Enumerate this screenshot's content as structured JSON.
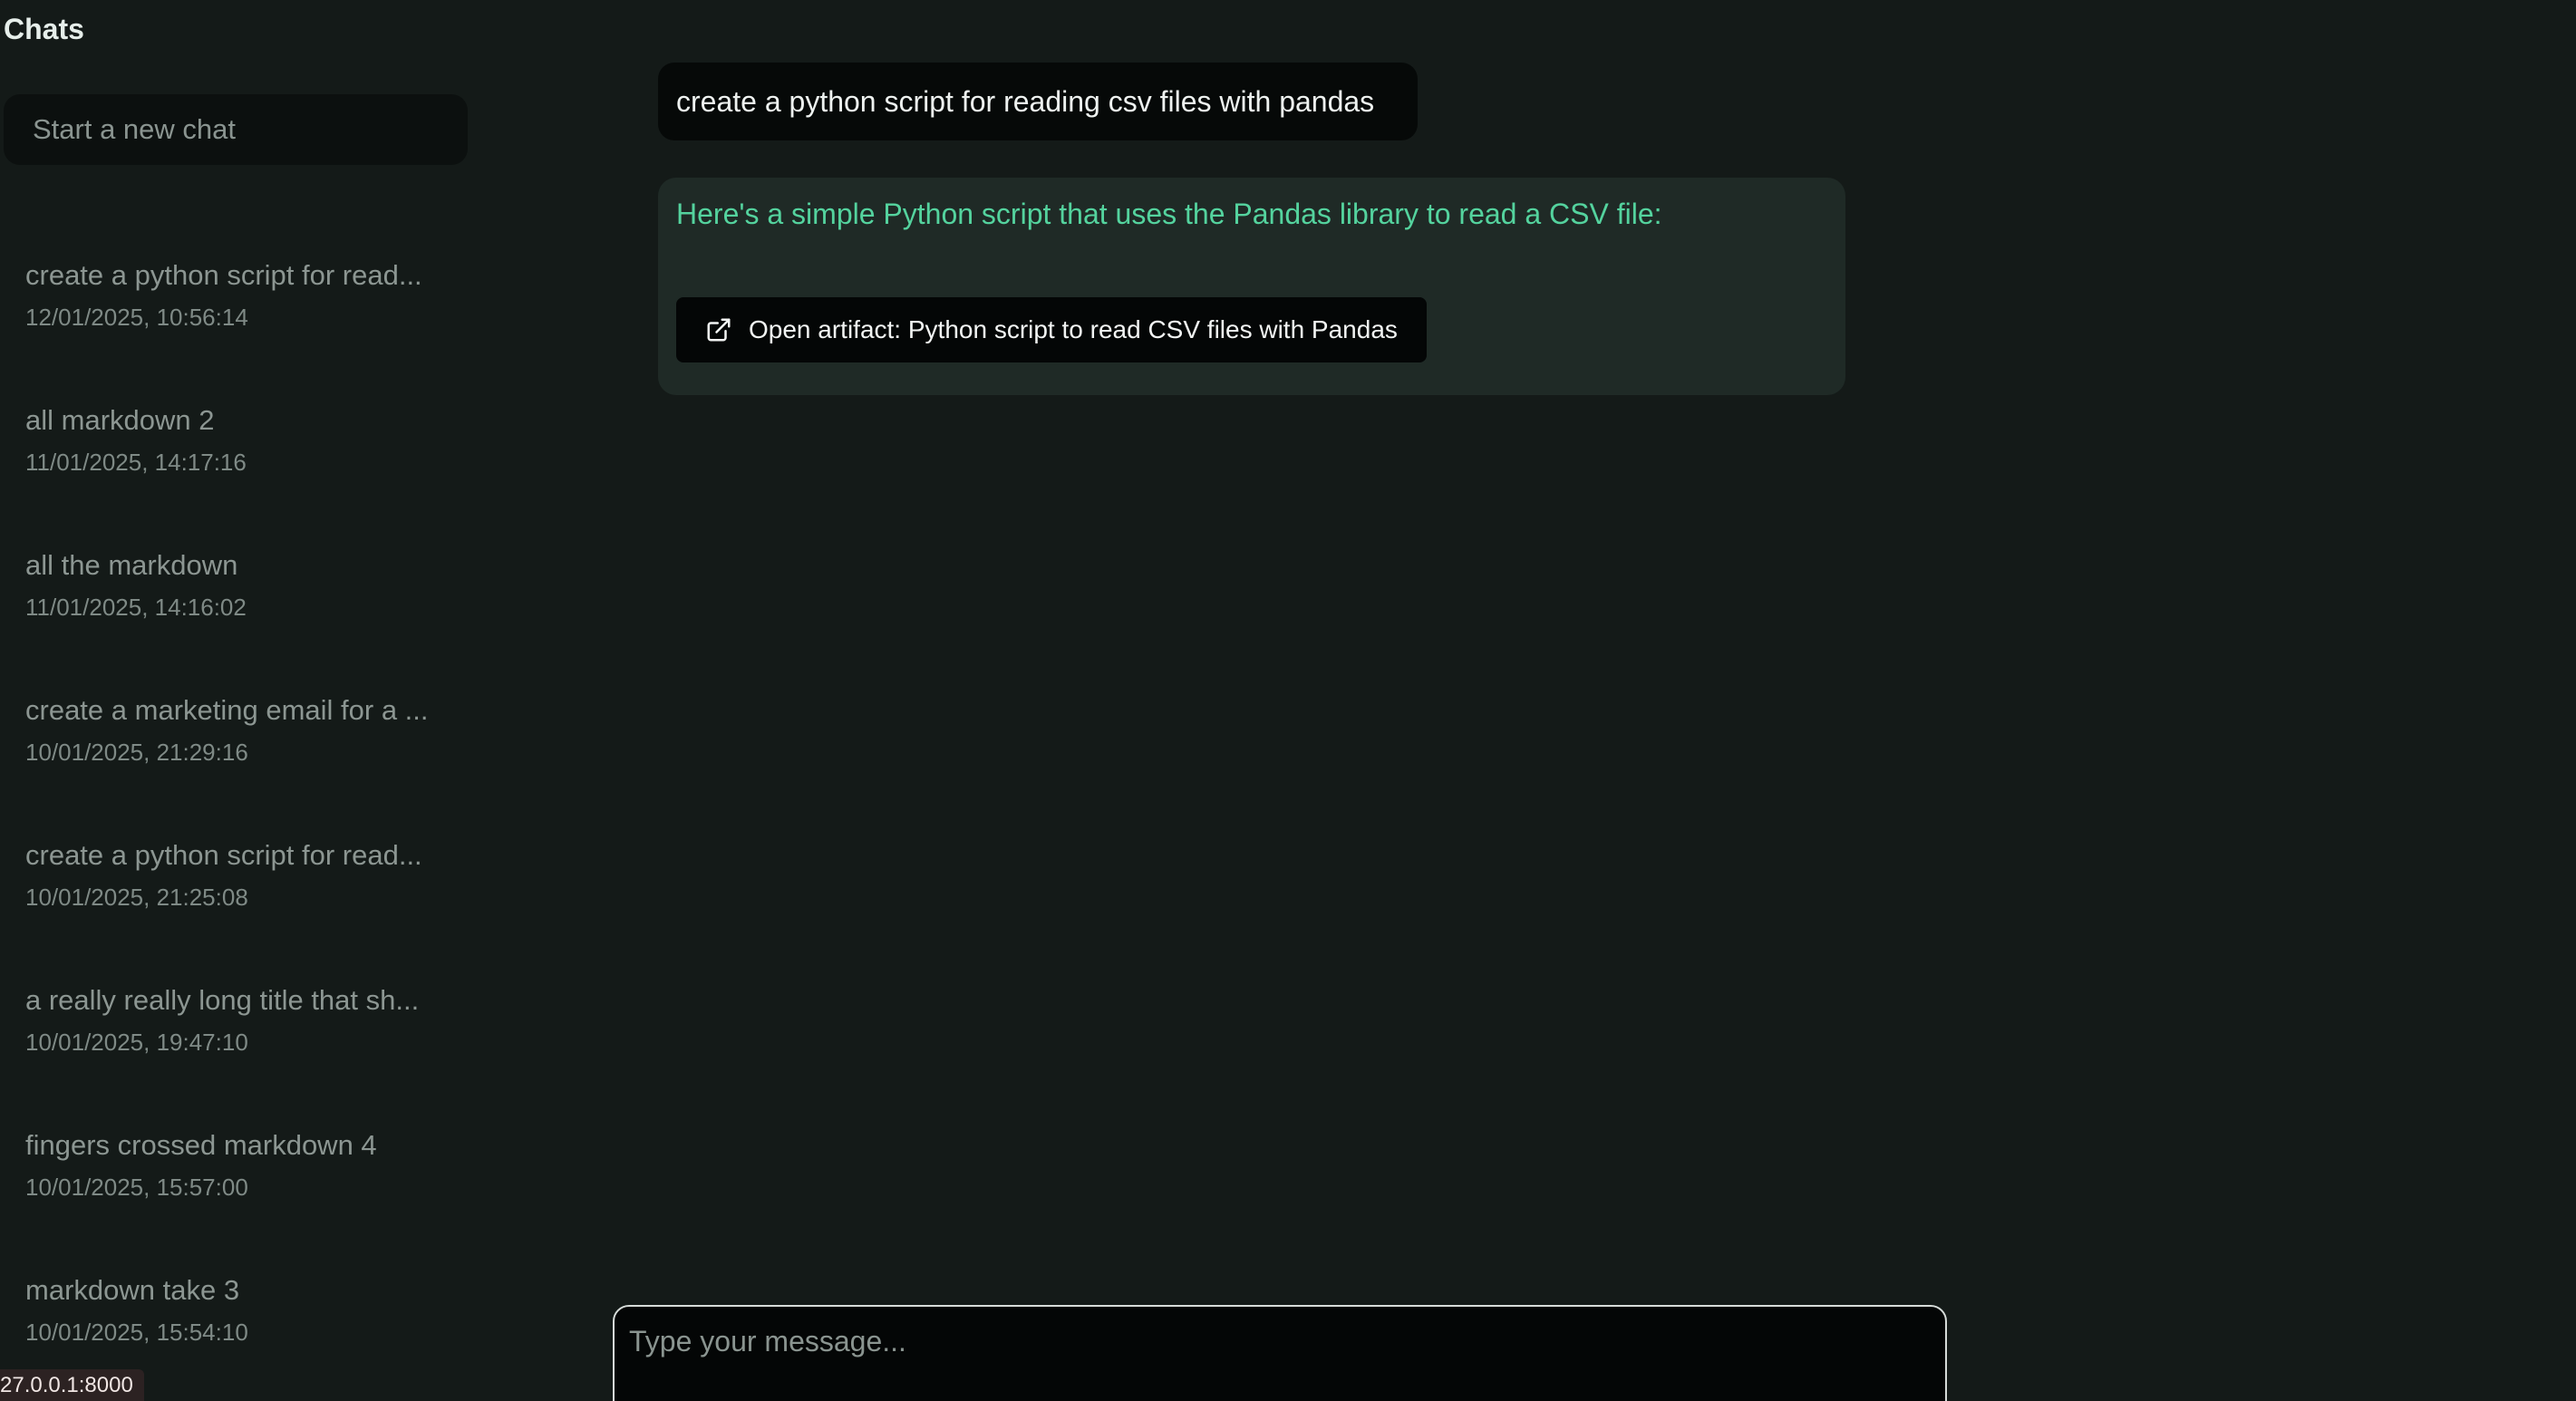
{
  "sidebar": {
    "title": "Chats",
    "new_chat_placeholder": "Start a new chat",
    "items": [
      {
        "title": "create a python script for read...",
        "time": "12/01/2025, 10:56:14"
      },
      {
        "title": "all markdown 2",
        "time": "11/01/2025, 14:17:16"
      },
      {
        "title": "all the markdown",
        "time": "11/01/2025, 14:16:02"
      },
      {
        "title": "create a marketing email for a ...",
        "time": "10/01/2025, 21:29:16"
      },
      {
        "title": "create a python script for read...",
        "time": "10/01/2025, 21:25:08"
      },
      {
        "title": "a really really long title that sh...",
        "time": "10/01/2025, 19:47:10"
      },
      {
        "title": "fingers crossed markdown 4",
        "time": "10/01/2025, 15:57:00"
      },
      {
        "title": "markdown take 3",
        "time": "10/01/2025, 15:54:10"
      }
    ]
  },
  "status_bar": {
    "url": "27.0.0.1:8000"
  },
  "conversation": {
    "user_message": "create a python script for reading csv files with pandas",
    "assistant_message": "Here's a simple Python script that uses the Pandas library to read a CSV file:",
    "artifact_button_label": "Open artifact: Python script to read CSV files with Pandas",
    "artifact_icon": "external-link-icon"
  },
  "composer": {
    "placeholder": "Type your message..."
  },
  "colors": {
    "background": "#141a18",
    "assistant_bubble": "#1f2a26",
    "assistant_text": "#54d39e",
    "user_bubble": "#060908"
  }
}
